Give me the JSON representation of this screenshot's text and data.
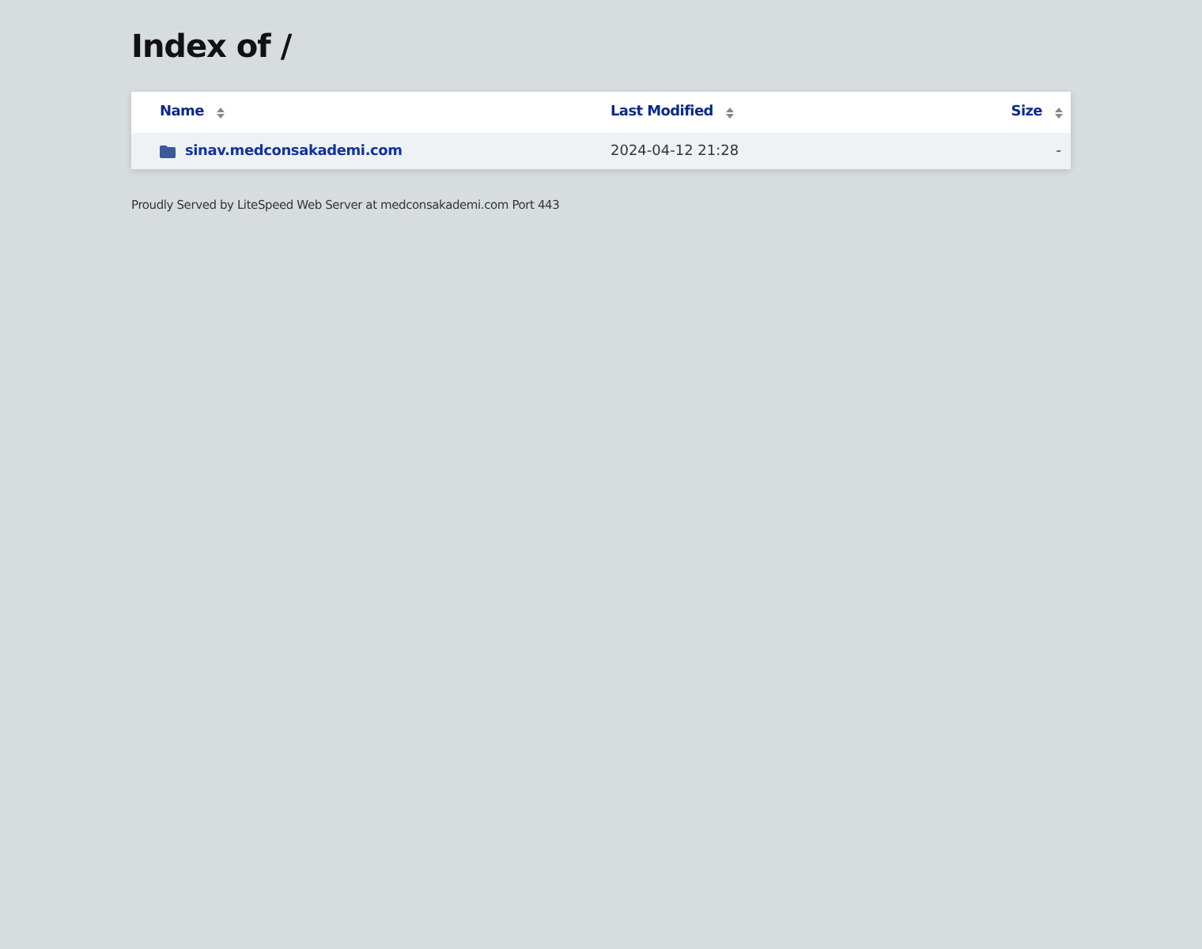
{
  "title": "Index of /",
  "table": {
    "columns": [
      {
        "label": "Name"
      },
      {
        "label": "Last Modified"
      },
      {
        "label": "Size"
      }
    ],
    "rows": [
      {
        "kind": "folder",
        "name": "sinav.medconsakademi.com",
        "modified": "2024-04-12 21:28",
        "size": "-"
      }
    ]
  },
  "footer": "Proudly Served by LiteSpeed Web Server at medconsakademi.com Port 443"
}
